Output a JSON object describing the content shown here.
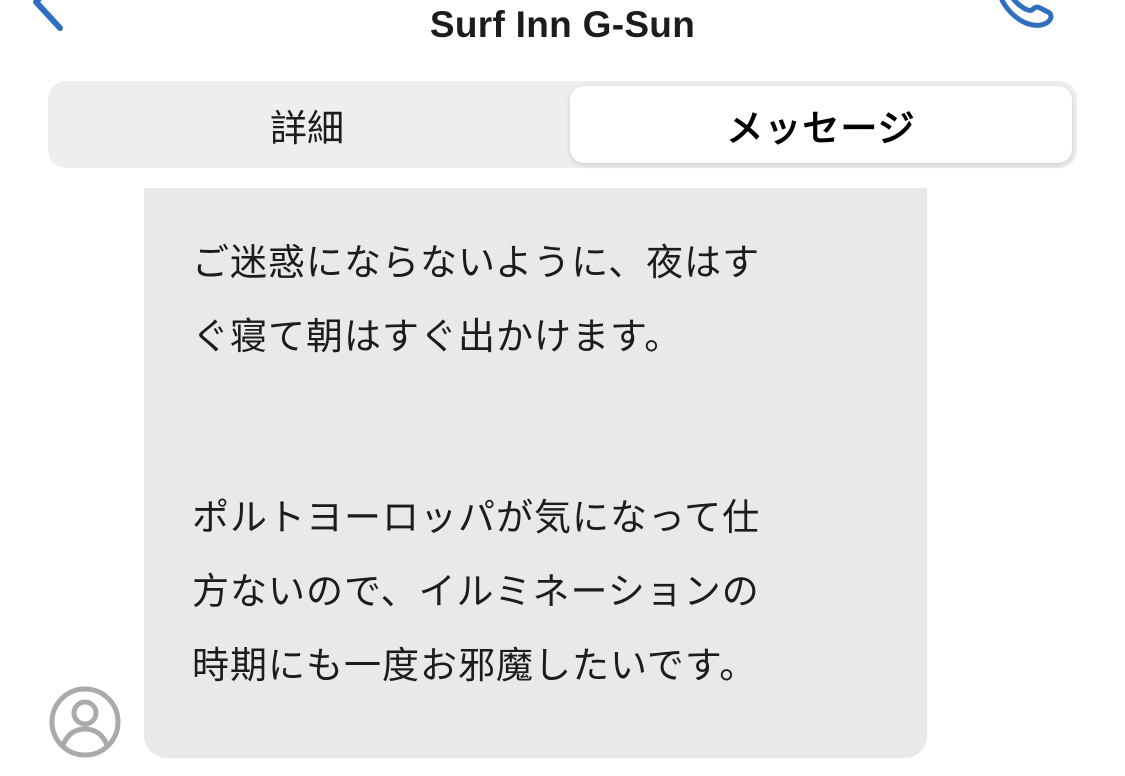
{
  "header": {
    "title": "Surf Inn G-Sun",
    "back_icon": "chevron-left-icon",
    "call_icon": "phone-icon",
    "accent_color": "#2f6fbf"
  },
  "tabs": [
    {
      "label": "詳細",
      "selected": false
    },
    {
      "label": "メッセージ",
      "selected": true
    }
  ],
  "message": {
    "paragraph1": [
      "ご迷惑にならないように、夜はす",
      "ぐ寝て朝はすぐ出かけます。"
    ],
    "paragraph2": [
      "ポルトヨーロッパが気になって仕",
      "方ないので、イルミネーションの",
      "時期にも一度お邪魔したいです。"
    ],
    "bubble_color": "#e9e9eb"
  },
  "avatar": {
    "icon": "person-icon"
  }
}
